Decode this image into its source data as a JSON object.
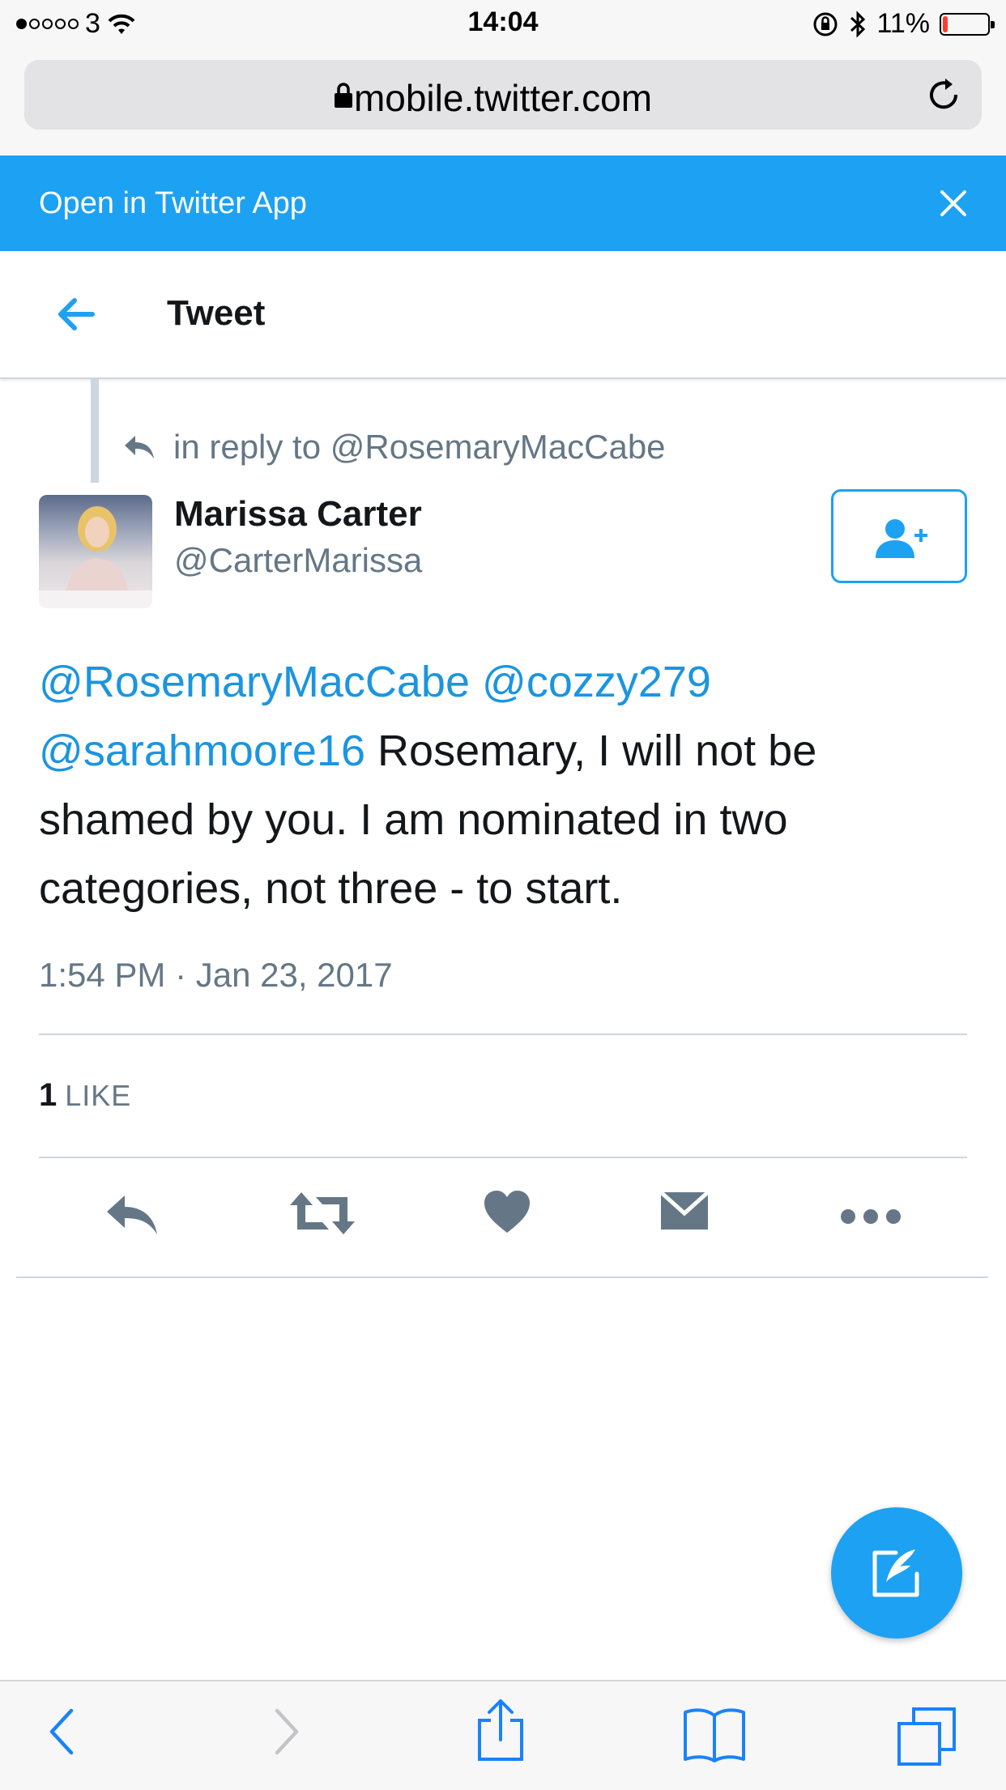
{
  "status_bar": {
    "carrier": "3",
    "time": "14:04",
    "battery": "11%",
    "battery_level": 0.11,
    "signal_bars_filled": 1,
    "signal_bars_total": 5
  },
  "browser": {
    "url": "mobile.twitter.com"
  },
  "app_banner": {
    "text": "Open in Twitter App"
  },
  "header": {
    "title": "Tweet"
  },
  "reply_context": {
    "prefix": "in reply to",
    "target": "@RosemaryMacCabe"
  },
  "tweet": {
    "author_name": "Marissa Carter",
    "author_handle": "@CarterMarissa",
    "mentions": [
      "@RosemaryMacCabe",
      "@cozzy279",
      "@sarahmoore16"
    ],
    "body": "Rosemary, I will not be shamed by you. I am nominated in two categories, not three - to start.",
    "timestamp": "1:54 PM · Jan 23, 2017",
    "likes_count": "1",
    "likes_label": "LIKE"
  },
  "actions": [
    "reply-icon",
    "retweet-icon",
    "heart-icon",
    "direct-message-icon",
    "more-icon"
  ],
  "colors": {
    "accent": "#1da1f2",
    "mention": "#1b95e0",
    "muted": "#657786",
    "icon": "#657786"
  }
}
